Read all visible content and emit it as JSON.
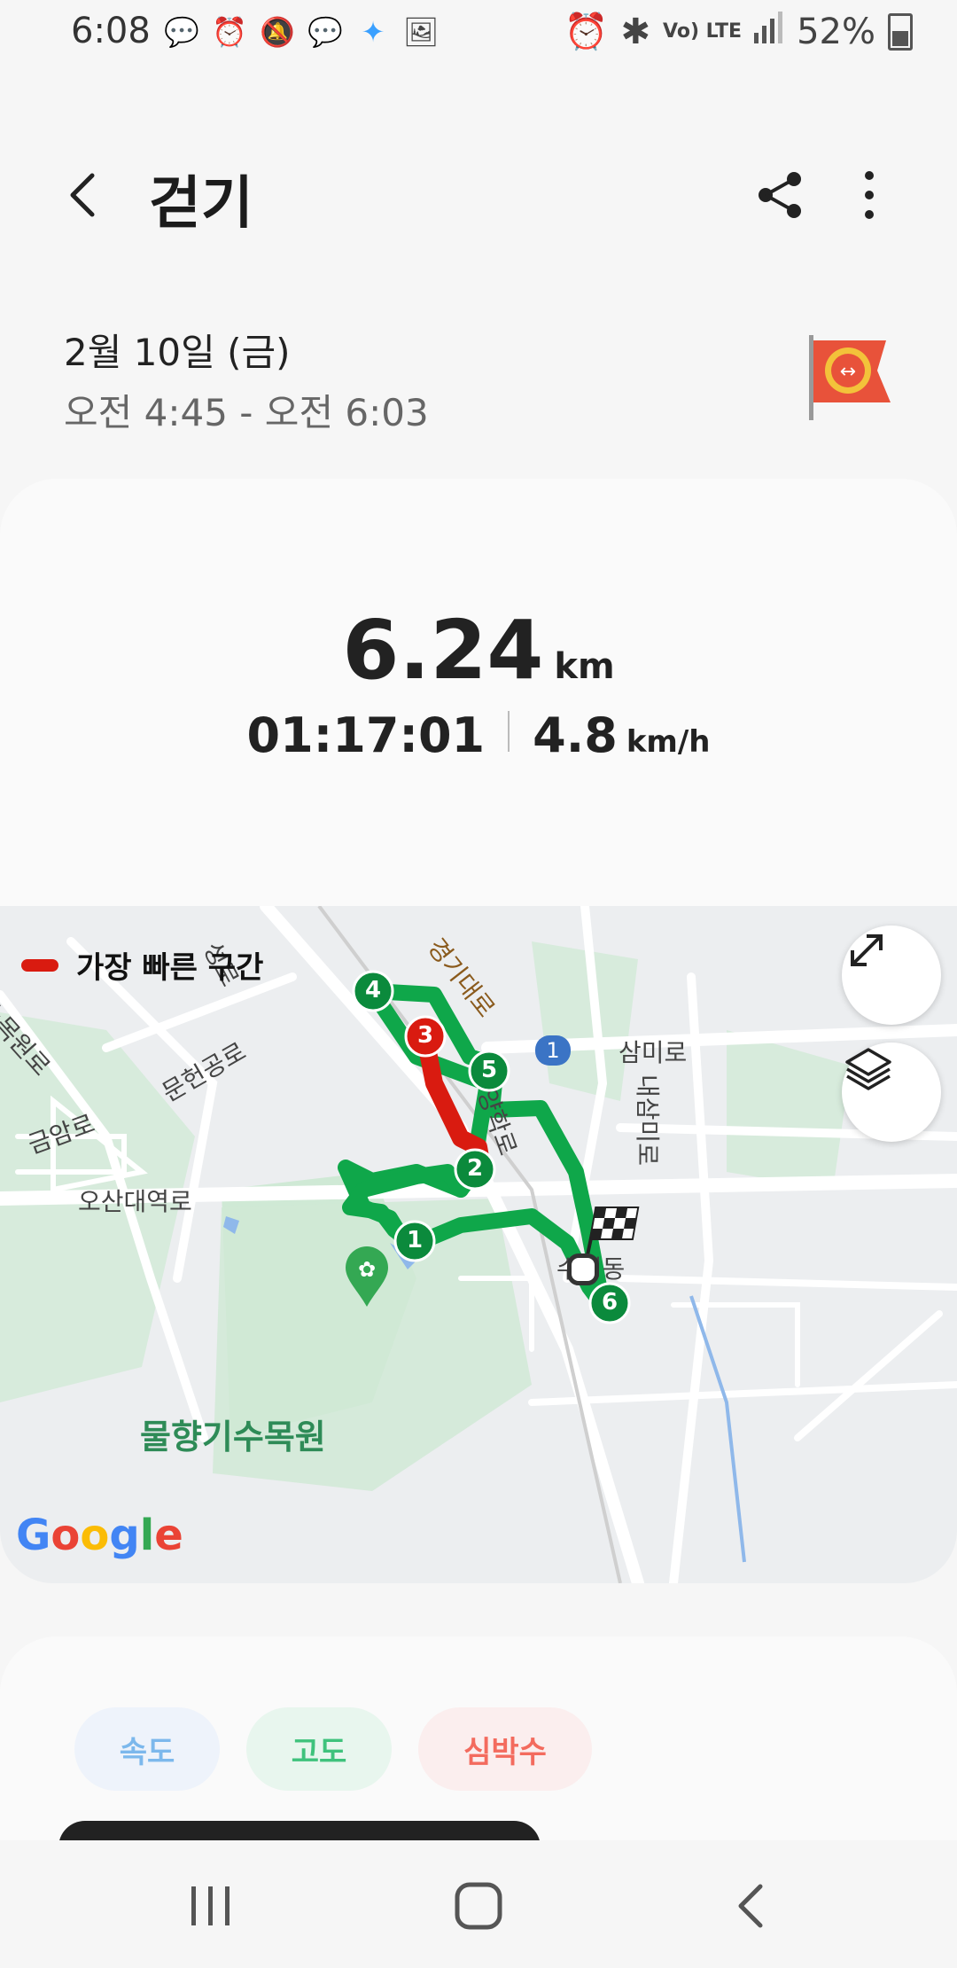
{
  "status_bar": {
    "time": "6:08",
    "left_icons": [
      "chat-icon",
      "alarm-icon",
      "mute-icon",
      "chat-icon",
      "sparkle-icon",
      "image-icon"
    ],
    "right_icons": [
      "alarm-icon",
      "bluetooth-icon",
      "volte-icon",
      "lte-icon",
      "signal-icon"
    ],
    "volte_label": "Vo) LTE",
    "lte_label": "LTE",
    "battery": "52%"
  },
  "header": {
    "title": "걷기",
    "back_icon": "chevron-left-icon",
    "share_icon": "share-icon",
    "more_icon": "more-vertical-icon"
  },
  "session": {
    "date": "2월 10일 (금)",
    "time_range": "오전 4:45 - 오전 6:03",
    "badge_icon": "flag-badge-icon"
  },
  "summary": {
    "distance": "6.24",
    "distance_unit": "km",
    "duration": "01:17:01",
    "speed": "4.8",
    "speed_unit": "km/h"
  },
  "map": {
    "legend_label": "가장 빠른 구간",
    "colors": {
      "route": "#0fa74a",
      "fastest": "#d91b10",
      "water": "#8fb8ea",
      "park": "#cfe9d5"
    },
    "road_labels": [
      "수목원로",
      "성로",
      "문헌공로",
      "경기대로",
      "삼미로",
      "내삼미로",
      "양학로",
      "금암로",
      "오산대역로",
      "수청동"
    ],
    "poi": "물향기수목원",
    "route_markers": [
      "1",
      "2",
      "3",
      "4",
      "5",
      "6"
    ],
    "highway_badge": "1",
    "attribution": {
      "G": "G",
      "o1": "o",
      "o2": "o",
      "g": "g",
      "l": "l",
      "e": "e"
    }
  },
  "metrics_tabs": {
    "speed": "속도",
    "altitude": "고도",
    "heart_rate": "심박수"
  }
}
